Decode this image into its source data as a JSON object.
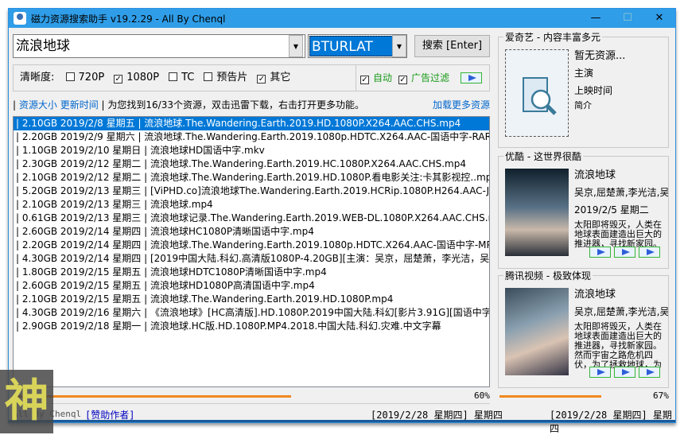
{
  "window": {
    "title": "磁力资源搜索助手 v19.2.29 - All By Chenql",
    "minimize": "—",
    "maximize": "☐",
    "close": "✕"
  },
  "search": {
    "query": "流浪地球",
    "source": "BTURLAT",
    "button": "搜索 [Enter]"
  },
  "filters": {
    "label": "清晰度:",
    "options": [
      {
        "label": "720P",
        "checked": false
      },
      {
        "label": "1080P",
        "checked": true
      },
      {
        "label": "TC",
        "checked": false
      },
      {
        "label": "预告片",
        "checked": false
      },
      {
        "label": "其它",
        "checked": true
      }
    ],
    "auto": {
      "label": "自动",
      "checked": true
    },
    "adfilter": {
      "label": "广告过滤",
      "checked": true
    }
  },
  "infobar": {
    "sort_size": "资源大小",
    "sort_time": "更新时间",
    "message": "为您找到16/33个资源，双击迅雷下载，右击打开更多功能。",
    "load_more": "加载更多资源"
  },
  "results": [
    "| 2.10GB 2019/2/8 星期五 | 流浪地球.The.Wandering.Earth.2019.HD.1080P.X264.AAC.CHS.mp4",
    "| 2.20GB 2019/2/9 星期六 | 流浪地球.The.Wandering.Earth.2019.1080p.HDTC.X264.AAC-国语中字-RARBT",
    "| 1.10GB 2019/2/10 星期日 | 流浪地球HD国语中字.mkv",
    "| 2.30GB 2019/2/12 星期二 | 流浪地球.The.Wandering.Earth.2019.HC.1080P.X264.AAC.CHS.mp4",
    "| 2.10GB 2019/2/12 星期二 | 流浪地球.The.Wandering.Earth.2019.HD.1080P.看电影关注:卡其影视控..mp4",
    "| 5.20GB 2019/2/13 星期三 | [ViPHD.co]流浪地球The.Wandering.Earth.2019.HCRip.1080P.H264.AAC-JBY.r",
    "| 2.10GB 2019/2/13 星期三 | 流浪地球.mp4",
    "| 0.61GB 2019/2/13 星期三 | 流浪地球记录.The.Wandering.Earth.2019.WEB-DL.1080P.X264.AAC.CHS.mp4",
    "| 2.60GB 2019/2/14 星期四 | 流浪地球HC1080P清晰国语中字.mp4",
    "| 2.20GB 2019/2/14 星期四 | 流浪地球.The.Wandering.Earth.2019.1080p.HDTC.X264.AAC-国语中字-MP4BA",
    "| 4.30GB 2019/2/14 星期四 | [2019中国大陆.科幻.高清版1080P-4.20GB][主演：吴京，屈楚萧，李光洁，吴孟达",
    "| 1.80GB 2019/2/15 星期五 | 流浪地球HDTC1080P清晰国语中字.mp4",
    "| 2.60GB 2019/2/15 星期五 | 流浪地球HD1080P高清国语中字.mp4",
    "| 2.10GB 2019/2/15 星期五 | 流浪地球.The.Wandering.Earth.2019.HD.1080P.mp4",
    "| 4.30GB 2019/2/16 星期六 | 《流浪地球》[HC高清版].HD.1080P.2019中国大陆.科幻[影片3.91G][国语中字]",
    "| 2.90GB 2019/2/18 星期一 | 流浪地球.HC版.HD.1080P.MP4.2018.中国大陆.科幻.灾难.中文字幕"
  ],
  "left_progress": {
    "value": 60,
    "label": "60%"
  },
  "status_left": {
    "author": "All By Chenql",
    "sponsor": "[赞助作者]",
    "date": "[2019/2/28 星期四] 星期四"
  },
  "panels": [
    {
      "title": "爱奇艺 - 内容丰富多元",
      "name": "暂无资源...",
      "actors": "主演",
      "date": "上映时间",
      "desc": "简介"
    },
    {
      "title": "优酷 - 这世界很酷",
      "name": "流浪地球",
      "actors": "吴京,屈楚萧,李光洁,吴",
      "date": "2019/2/5 星期二",
      "desc": "太阳即将毁灭，人类在地球表面建造出巨大的推进器，寻找新家园。"
    },
    {
      "title": "腾讯视频 - 极致体现",
      "name": "流浪地球",
      "actors": "吴京,屈楚萧,李光洁,吴",
      "desc": "太阳即将毁灭，人类在地球表面建造出巨大的推进器，寻找新家园。然而宇宙之路危机四伏，为了拯救地球，为了"
    }
  ],
  "right_progress": {
    "value": 67,
    "label": "67%"
  },
  "status_right": {
    "date": "[2019/2/28 星期四] 星期四"
  },
  "watermark": "神",
  "colors": {
    "titlebar": "#2f9de8",
    "selection": "#0078d7",
    "progress": "#f0891e",
    "link": "#0066cc",
    "green": "#1a9a1a"
  }
}
